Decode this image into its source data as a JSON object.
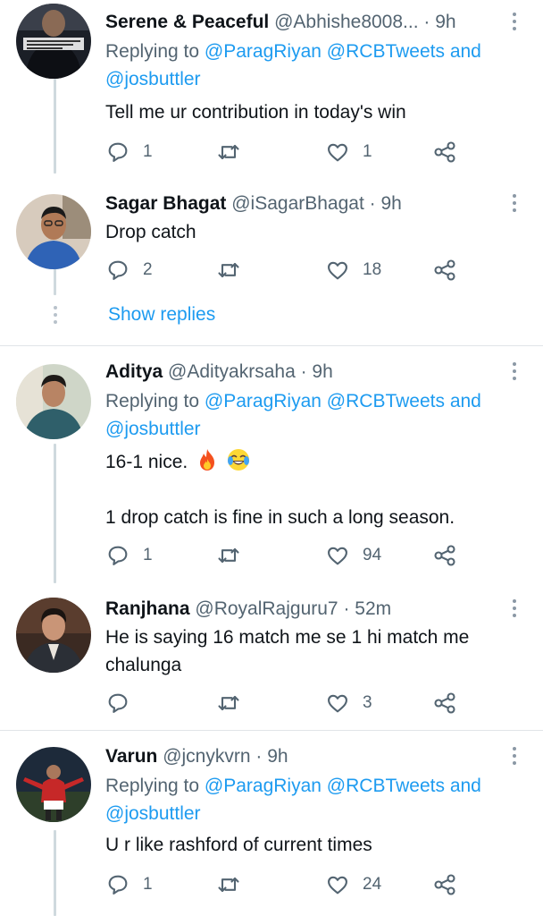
{
  "replying_label": "Replying to",
  "show_replies": "Show replies",
  "colors": {
    "accent": "#1d9bf0",
    "text": "#0f1419",
    "muted": "#536471"
  },
  "icons": {
    "reply": "reply-icon",
    "retweet": "retweet-icon",
    "like": "heart-icon",
    "share": "share-icon",
    "more": "more-options-icon"
  },
  "tweets": [
    {
      "name": "Serene & Peaceful",
      "handle": "@Abhishe8008...",
      "time": "· 9h",
      "mentions": [
        "@ParagRiyan",
        "@RCBTweets",
        "and",
        "@josbuttler"
      ],
      "text": "Tell me ur contribution in today's win",
      "replies": "1",
      "retweets": "",
      "likes": "1"
    },
    {
      "name": "Sagar Bhagat",
      "handle": "@iSagarBhagat",
      "time": "· 9h",
      "text": "Drop catch",
      "replies": "2",
      "retweets": "",
      "likes": "18"
    },
    {
      "name": "Aditya",
      "handle": "@Adityakrsaha",
      "time": "· 9h",
      "mentions": [
        "@ParagRiyan",
        "@RCBTweets",
        "and",
        "@josbuttler"
      ],
      "text_line1": "16-1 nice.",
      "emojis": [
        "fire-emoji",
        "joy-emoji"
      ],
      "text_line2": "1 drop catch is fine in such a long season.",
      "replies": "1",
      "retweets": "",
      "likes": "94"
    },
    {
      "name": "Ranjhana",
      "handle": "@RoyalRajguru7",
      "time": "· 52m",
      "text_line1": "He is saying 16 match me se 1 hi match me",
      "text_line2": "chalunga",
      "replies": "",
      "retweets": "",
      "likes": "3"
    },
    {
      "name": "Varun",
      "handle": "@jcnykvrn",
      "time": "· 9h",
      "mentions": [
        "@ParagRiyan",
        "@RCBTweets",
        "and",
        "@josbuttler"
      ],
      "text": "U r like rashford of current times",
      "replies": "1",
      "retweets": "",
      "likes": "24"
    }
  ]
}
